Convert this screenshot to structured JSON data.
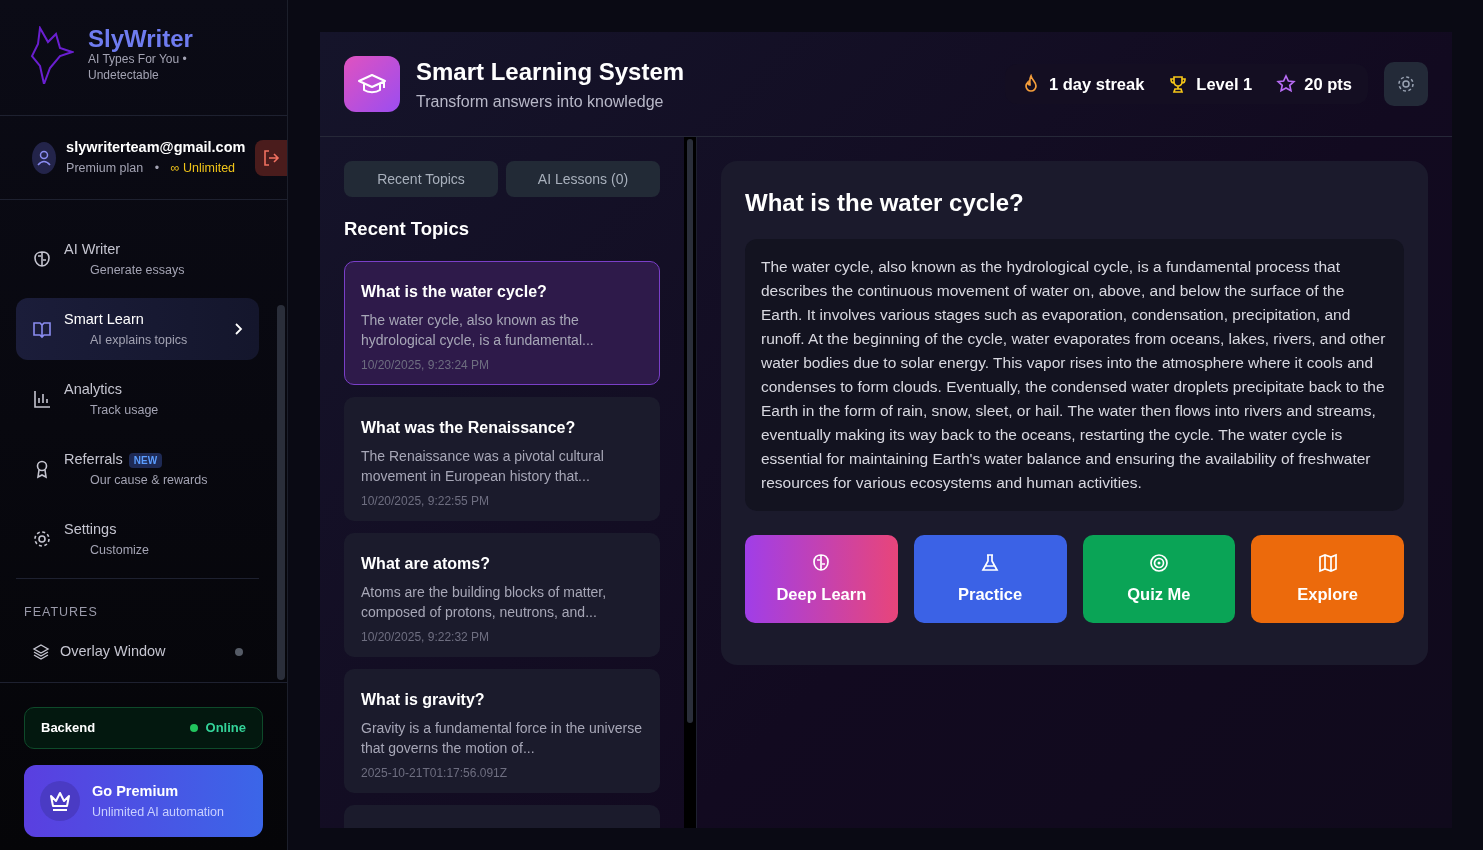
{
  "brand": {
    "name": "SlyWriter",
    "tagline": "AI Types For You • Undetectable"
  },
  "user": {
    "email": "slywriterteam@gmail.com",
    "plan": "Premium plan",
    "sep": "•",
    "quota": "∞ Unlimited"
  },
  "nav": [
    {
      "title": "AI Writer",
      "subtitle": "Generate essays",
      "kind": "brain",
      "selected": false
    },
    {
      "title": "Smart Learn",
      "subtitle": "AI explains topics",
      "kind": "book",
      "selected": true
    },
    {
      "title": "Analytics",
      "subtitle": "Track usage",
      "kind": "chart",
      "selected": false
    },
    {
      "title": "Referrals",
      "subtitle": "Our cause & rewards",
      "kind": "award",
      "selected": false,
      "badge": "NEW"
    },
    {
      "title": "Settings",
      "subtitle": "Customize",
      "kind": "gear",
      "selected": false
    }
  ],
  "features": {
    "heading": "FEATURES",
    "items": [
      {
        "label": "Overlay Window",
        "on": false
      }
    ]
  },
  "backend": {
    "label": "Backend",
    "status": "Online",
    "online": true
  },
  "premium": {
    "title": "Go Premium",
    "subtitle": "Unlimited AI automation"
  },
  "header": {
    "title": "Smart Learning System",
    "subtitle": "Transform answers into knowledge",
    "stats": [
      {
        "kind": "streak",
        "text": "1 day streak"
      },
      {
        "kind": "level",
        "text": "Level 1"
      },
      {
        "kind": "points",
        "text": "20 pts"
      }
    ]
  },
  "tabs": [
    {
      "label": "Recent Topics",
      "selected": false
    },
    {
      "label": "AI Lessons (0)",
      "selected": false
    }
  ],
  "list_heading": "Recent Topics",
  "topics": [
    {
      "title": "What is the water cycle?",
      "preview": "The water cycle, also known as the hydrological cycle, is a fundamental...",
      "time": "10/20/2025, 9:23:24 PM",
      "selected": true
    },
    {
      "title": "What was the Renaissance?",
      "preview": "The Renaissance was a pivotal cultural movement in European history that...",
      "time": "10/20/2025, 9:22:55 PM",
      "selected": false
    },
    {
      "title": "What are atoms?",
      "preview": "Atoms are the building blocks of matter, composed of protons, neutrons, and...",
      "time": "10/20/2025, 9:22:32 PM",
      "selected": false
    },
    {
      "title": "What is gravity?",
      "preview": "Gravity is a fundamental force in the universe that governs the motion of...",
      "time": "2025-10-21T01:17:56.091Z",
      "selected": false
    }
  ],
  "answer": {
    "question": "What is the water cycle?",
    "text": "The water cycle, also known as the hydrological cycle, is a fundamental process that describes the continuous movement of water on, above, and below the surface of the Earth. It involves various stages such as evaporation, condensation, precipitation, and runoff. At the beginning of the cycle, water evaporates from oceans, lakes, rivers, and other water bodies due to solar energy. This vapor rises into the atmosphere where it cools and condenses to form clouds. Eventually, the condensed water droplets precipitate back to the Earth in the form of rain, snow, sleet, or hail. The water then flows into rivers and streams, eventually making its way back to the oceans, restarting the cycle. The water cycle is essential for maintaining Earth's water balance and ensuring the availability of freshwater resources for various ecosystems and human activities."
  },
  "actions": [
    {
      "kind": "deep",
      "label": "Deep Learn"
    },
    {
      "kind": "practice",
      "label": "Practice"
    },
    {
      "kind": "quiz",
      "label": "Quiz Me"
    },
    {
      "kind": "explore",
      "label": "Explore"
    }
  ]
}
